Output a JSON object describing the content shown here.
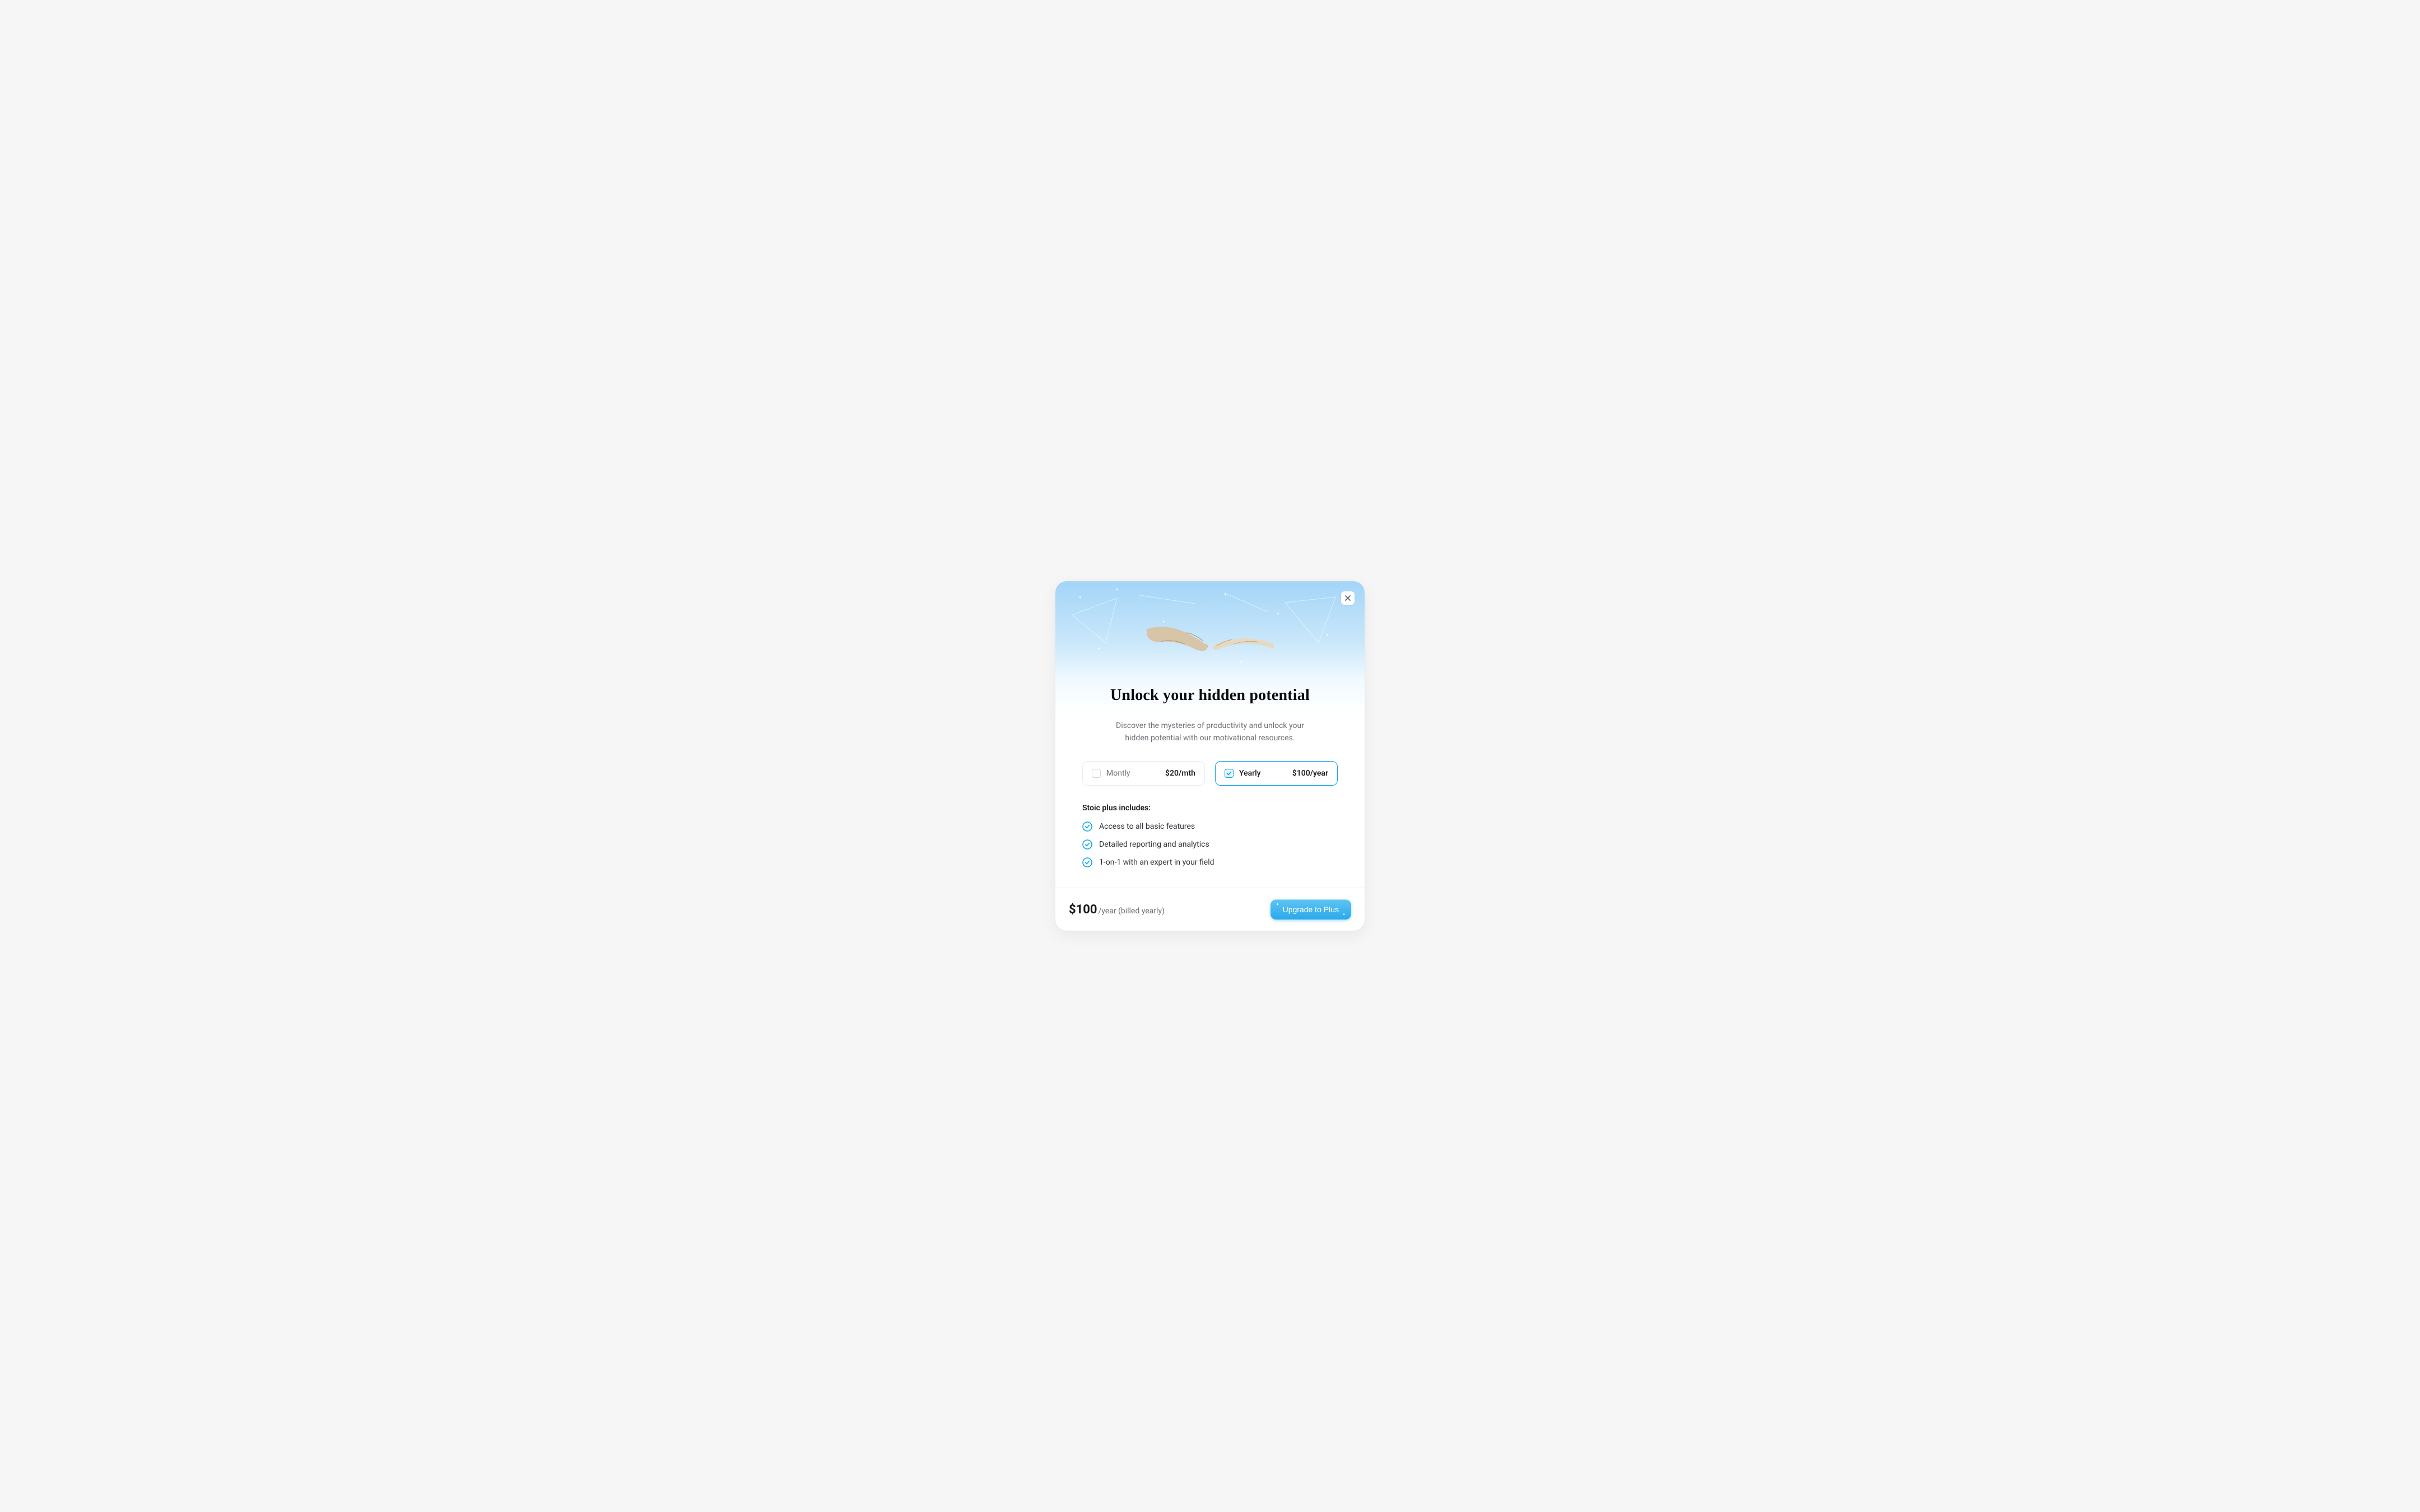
{
  "headline": "Unlock  your hidden potential",
  "subtext": "Discover the mysteries of productivity and unlock your hidden potential with our motivational resources.",
  "plans": {
    "monthly": {
      "label": "Montly",
      "price": "$20/mth",
      "selected": false
    },
    "yearly": {
      "label": "Yearly",
      "price": "$100/year",
      "selected": true
    }
  },
  "includes_title": "Stoic plus includes:",
  "features": [
    "Access to all basic features",
    "Detailed reporting and analytics",
    "1-on-1 with an expert in your field"
  ],
  "footer": {
    "price": "$100",
    "suffix": "/year (billed yearly)",
    "cta": "Upgrade to Plus"
  },
  "colors": {
    "accent": "#0ea5e9"
  }
}
